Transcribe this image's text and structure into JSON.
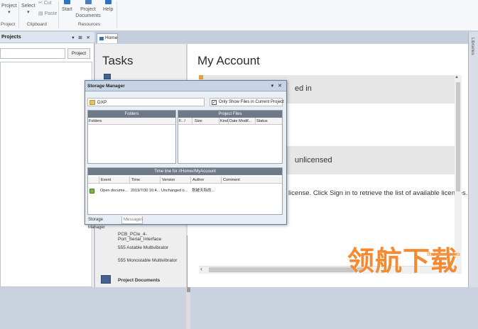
{
  "ribbon": {
    "project_label": "Project",
    "select_label": "Select",
    "cut_label": "Cut",
    "paste_label": "Paste",
    "start_label": "Start",
    "project_documents_label": "Project Documents",
    "help_label": "Help",
    "group_project": "Project",
    "group_clipboard": "Clipboard",
    "group_resources": "Resources"
  },
  "projects_panel": {
    "title": "Projects",
    "controls": "▾ ⊞ ✕",
    "search_value": "",
    "project_button": "Project"
  },
  "tabs": {
    "home": "Home"
  },
  "tasks": {
    "title": "Tasks",
    "items": [
      "PCB_PCIe_4-Port_Serial_Interface",
      "555 Astable Multivibrator",
      "555 Monostable Multivibrator"
    ],
    "section_project_documents": "Project Documents"
  },
  "account": {
    "title": "My Account",
    "section1_text": "ed in",
    "section2_text": "unlicensed",
    "license_message": "license. Click Sign in to retrieve the list of available licenses."
  },
  "libraries": {
    "label": "Libraries"
  },
  "storage_manager": {
    "title": "Storage Manager",
    "controls": "▾ ✕",
    "path": "DXP",
    "show_current_label": "Only Show Files in Current Project",
    "show_current_checked": true,
    "folders_header": "Folders",
    "folders_columns": [
      "Folders"
    ],
    "files_header": "Project Files",
    "files_columns": [
      "F.. /",
      "Size",
      "Kind",
      "Date Modif...",
      "Status"
    ],
    "timeline_header": "Time line for //Home//MyAccount",
    "timeline_columns": [
      "Event",
      "Time",
      "Version",
      "Author",
      "Comment"
    ],
    "timeline_rows": [
      {
        "event": "Open docume...",
        "time": "2019/7/30 16:4...",
        "version": "Unchanged o...",
        "author": "划被天际的...",
        "comment": ""
      }
    ],
    "tabs": [
      "Storage Manager",
      "Messages"
    ]
  },
  "watermark": {
    "logo_text": "领航下载",
    "url": "lhdown.com"
  }
}
